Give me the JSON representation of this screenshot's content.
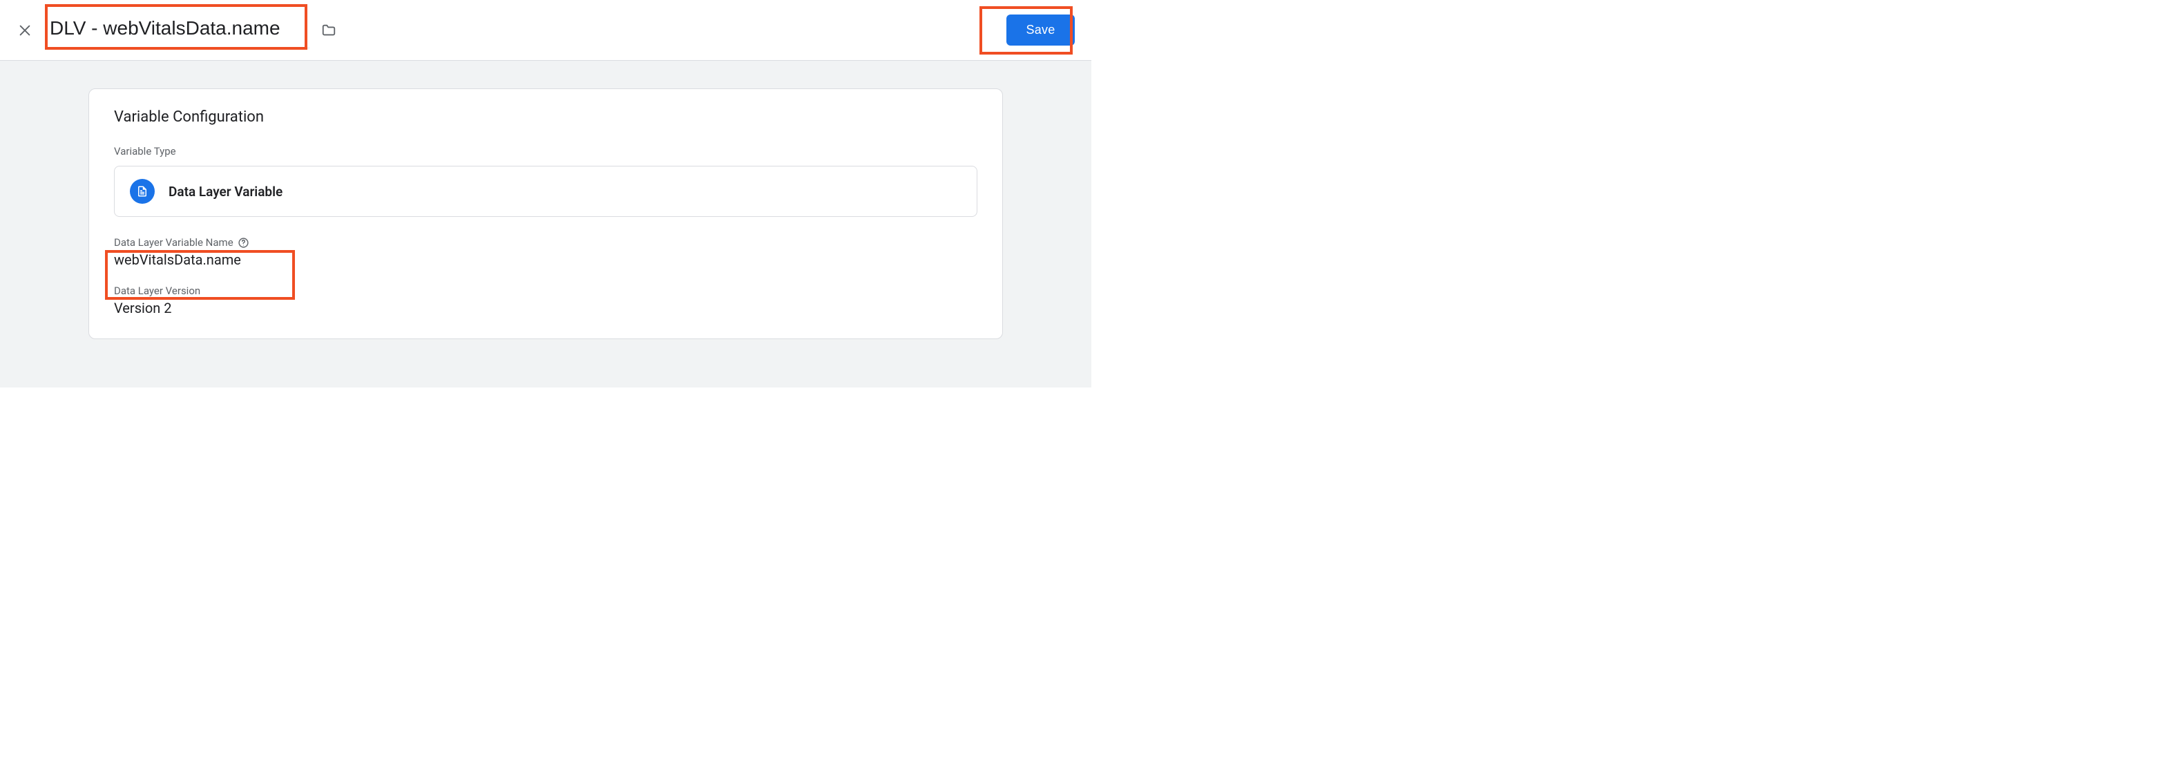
{
  "header": {
    "variable_name": "DLV - webVitalsData.name",
    "save_label": "Save"
  },
  "config": {
    "card_title": "Variable Configuration",
    "type_section_label": "Variable Type",
    "type_name": "Data Layer Variable",
    "dlv_name_label": "Data Layer Variable Name",
    "dlv_name_value": "webVitalsData.name",
    "dlv_version_label": "Data Layer Version",
    "dlv_version_value": "Version 2"
  },
  "colors": {
    "accent": "#1a73e8",
    "highlight": "#f04e23"
  }
}
